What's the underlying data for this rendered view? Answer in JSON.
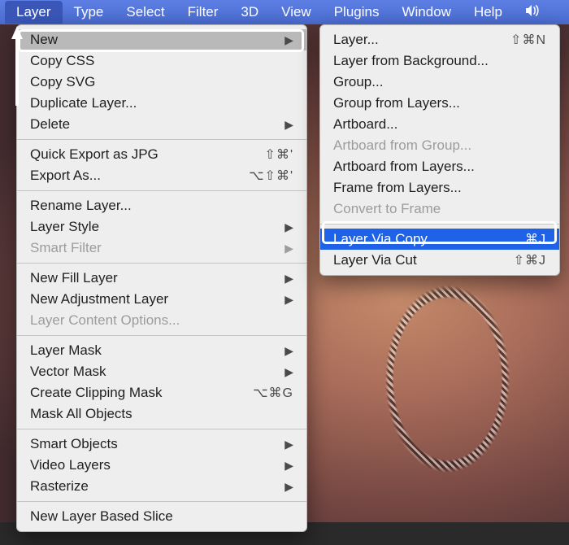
{
  "menubar": {
    "items": [
      {
        "label": "Layer",
        "open": true
      },
      {
        "label": "Type"
      },
      {
        "label": "Select"
      },
      {
        "label": "Filter"
      },
      {
        "label": "3D"
      },
      {
        "label": "View"
      },
      {
        "label": "Plugins"
      },
      {
        "label": "Window"
      },
      {
        "label": "Help"
      }
    ]
  },
  "layer_menu": {
    "new": {
      "label": "New",
      "hover": true
    },
    "copy_css": {
      "label": "Copy CSS"
    },
    "copy_svg": {
      "label": "Copy SVG"
    },
    "duplicate": {
      "label": "Duplicate Layer..."
    },
    "delete": {
      "label": "Delete"
    },
    "quick_export": {
      "label": "Quick Export as JPG",
      "shortcut": "⇧⌘'"
    },
    "export_as": {
      "label": "Export As...",
      "shortcut": "⌥⇧⌘'"
    },
    "rename": {
      "label": "Rename Layer..."
    },
    "layer_style": {
      "label": "Layer Style"
    },
    "smart_filter": {
      "label": "Smart Filter",
      "disabled": true
    },
    "new_fill": {
      "label": "New Fill Layer"
    },
    "new_adjustment": {
      "label": "New Adjustment Layer"
    },
    "layer_content": {
      "label": "Layer Content Options...",
      "disabled": true
    },
    "layer_mask": {
      "label": "Layer Mask"
    },
    "vector_mask": {
      "label": "Vector Mask"
    },
    "clipping_mask": {
      "label": "Create Clipping Mask",
      "shortcut": "⌥⌘G"
    },
    "mask_all": {
      "label": "Mask All Objects"
    },
    "smart_objects": {
      "label": "Smart Objects"
    },
    "video_layers": {
      "label": "Video Layers"
    },
    "rasterize": {
      "label": "Rasterize"
    },
    "slice": {
      "label": "New Layer Based Slice"
    }
  },
  "new_submenu": {
    "layer": {
      "label": "Layer...",
      "shortcut": "⇧⌘N"
    },
    "from_bg": {
      "label": "Layer from Background..."
    },
    "group": {
      "label": "Group..."
    },
    "group_from": {
      "label": "Group from Layers..."
    },
    "artboard": {
      "label": "Artboard..."
    },
    "artboard_group": {
      "label": "Artboard from Group...",
      "disabled": true
    },
    "artboard_layers": {
      "label": "Artboard from Layers..."
    },
    "frame_layers": {
      "label": "Frame from Layers..."
    },
    "convert_frame": {
      "label": "Convert to Frame",
      "disabled": true
    },
    "via_copy": {
      "label": "Layer Via Copy",
      "shortcut": "⌘J",
      "selected": true
    },
    "via_cut": {
      "label": "Layer Via Cut",
      "shortcut": "⇧⌘J"
    }
  }
}
